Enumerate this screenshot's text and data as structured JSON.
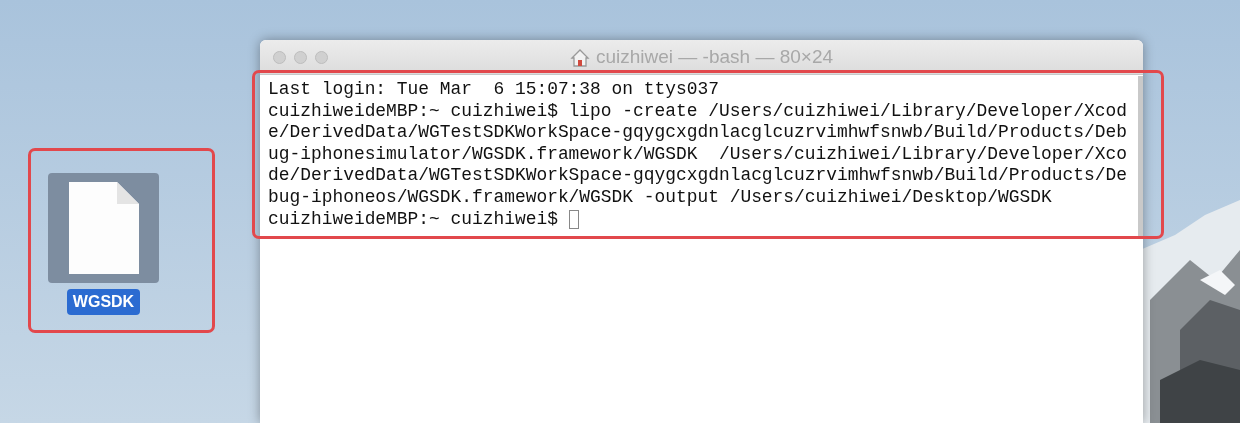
{
  "desktop_icons": [
    {
      "label": "WGSDK",
      "selected": true
    }
  ],
  "window": {
    "title": "cuizhiwei — -bash — 80×24",
    "active": false
  },
  "terminal": {
    "lines": [
      {
        "text": "Last login: Tue Mar  6 15:07:38 on ttys037",
        "cursor": false
      },
      {
        "text": "cuizhiweideMBP:~ cuizhiwei$ lipo -create /Users/cuizhiwei/Library/Developer/Xcod",
        "cursor": false
      },
      {
        "text": "e/DerivedData/WGTestSDKWorkSpace-gqygcxgdnlacglcuzrvimhwfsnwb/Build/Products/Deb",
        "cursor": false
      },
      {
        "text": "ug-iphonesimulator/WGSDK.framework/WGSDK  /Users/cuizhiwei/Library/Developer/Xco",
        "cursor": false
      },
      {
        "text": "de/DerivedData/WGTestSDKWorkSpace-gqygcxgdnlacglcuzrvimhwfsnwb/Build/Products/De",
        "cursor": false
      },
      {
        "text": "bug-iphoneos/WGSDK.framework/WGSDK -output /Users/cuizhiwei/Desktop/WGSDK",
        "cursor": false
      },
      {
        "text": "cuizhiweideMBP:~ cuizhiwei$ ",
        "cursor": true
      }
    ]
  }
}
